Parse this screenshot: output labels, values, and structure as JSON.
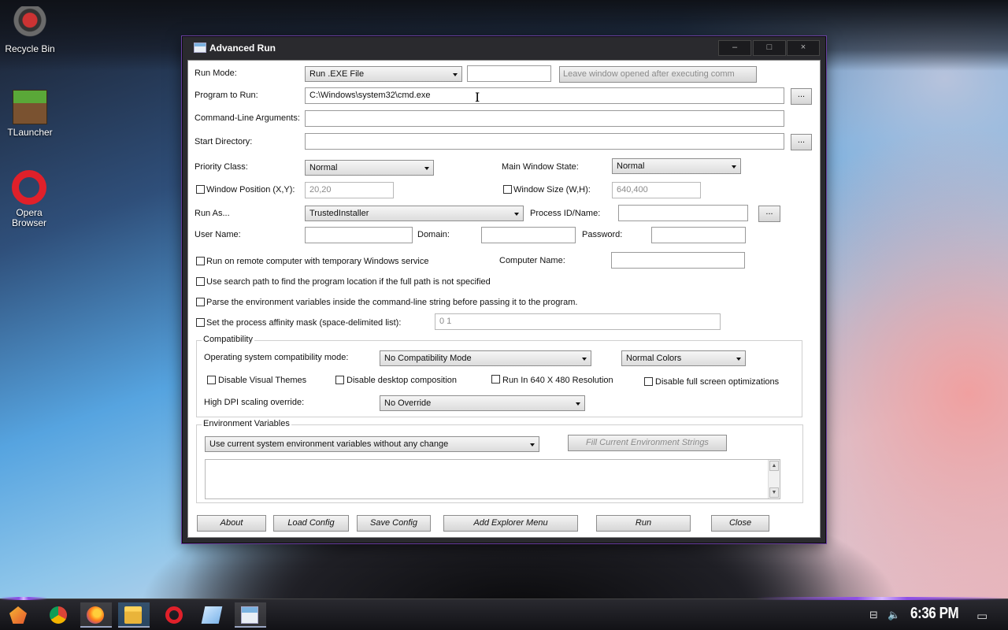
{
  "desktop": {
    "icons": [
      {
        "label": "Recycle Bin"
      },
      {
        "label": "TLauncher"
      },
      {
        "label": "Opera Browser"
      }
    ]
  },
  "window": {
    "title": "Advanced Run",
    "controls": {
      "minimize": "–",
      "maximize": "□",
      "close": "×"
    }
  },
  "form": {
    "run_mode_label": "Run Mode:",
    "run_mode_value": "Run .EXE File",
    "run_mode_extra": "",
    "leave_window_button": "Leave window opened after executing comm",
    "program_label": "Program to Run:",
    "program_value": "C:\\Windows\\system32\\cmd.exe",
    "browse_label": "...",
    "args_label": "Command-Line Arguments:",
    "args_value": "",
    "startdir_label": "Start Directory:",
    "startdir_value": "",
    "priority_label": "Priority Class:",
    "priority_value": "Normal",
    "main_window_state_label": "Main Window State:",
    "main_window_state_value": "Normal",
    "window_position_label": "Window Position (X,Y):",
    "window_position_value": "20,20",
    "window_size_label": "Window Size (W,H):",
    "window_size_value": "640,400",
    "run_as_label": "Run As...",
    "run_as_value": "TrustedInstaller",
    "process_id_label": "Process ID/Name:",
    "process_id_value": "",
    "user_name_label": "User Name:",
    "domain_label": "Domain:",
    "password_label": "Password:",
    "remote_label": "Run on remote computer with temporary Windows service",
    "computer_name_label": "Computer Name:",
    "search_path_label": "Use search path to find the program location if the full path is not specified",
    "parse_env_label": "Parse the environment variables inside the command-line string before passing it to the program.",
    "affinity_label": "Set the process affinity mask (space-delimited list):",
    "affinity_value": "0 1"
  },
  "compatibility": {
    "title": "Compatibility",
    "os_mode_label": "Operating system compatibility mode:",
    "os_mode_value": "No Compatibility Mode",
    "colors_value": "Normal Colors",
    "disable_visual_themes": "Disable Visual Themes",
    "disable_desktop_composition": "Disable desktop composition",
    "run_640": "Run In 640 X 480 Resolution",
    "disable_fullscreen_opt": "Disable full screen optimizations",
    "dpi_label": "High DPI scaling override:",
    "dpi_value": "No Override"
  },
  "environment": {
    "title": "Environment Variables",
    "mode_value": "Use current system environment variables without any change",
    "fill_button": "Fill Current Environment Strings"
  },
  "buttons": {
    "about": "About",
    "load_config": "Load Config",
    "save_config": "Save Config",
    "add_explorer_menu": "Add Explorer Menu",
    "run": "Run",
    "close": "Close"
  },
  "taskbar": {
    "clock": "6:36 PM",
    "apps": [
      "start",
      "chrome",
      "firefox",
      "file-explorer",
      "opera",
      "notepad",
      "advanced-run"
    ]
  }
}
